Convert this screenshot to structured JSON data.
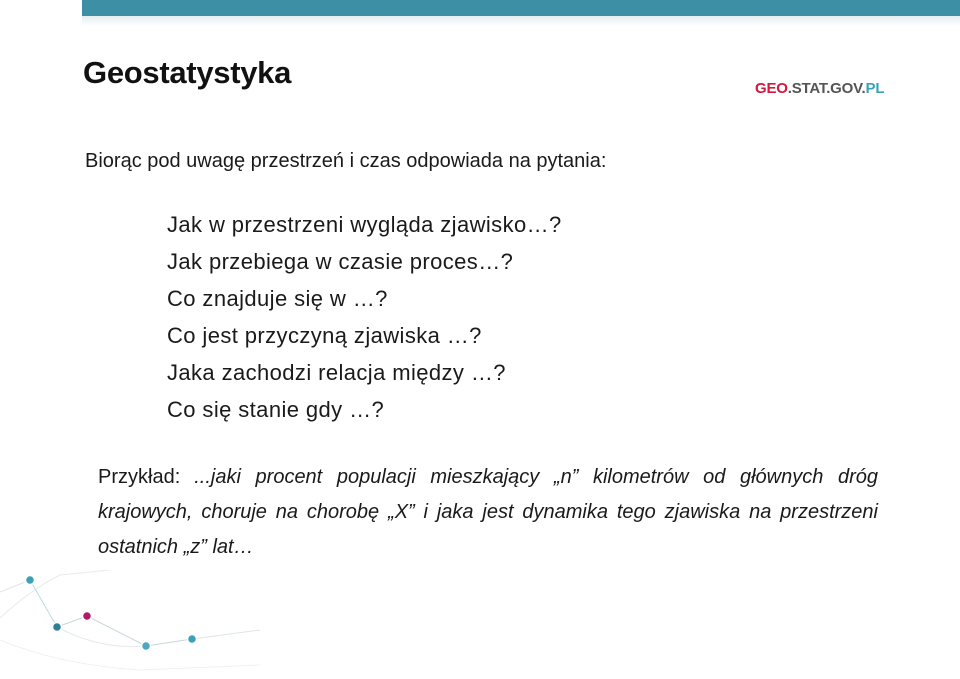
{
  "slide": {
    "title": "Geostatystyka",
    "logo": {
      "part1": "GEO",
      "part2": "STAT",
      "part3": "GOV",
      "part4": "PL"
    },
    "intro": "Biorąc pod uwagę przestrzeń i czas odpowiada na pytania:",
    "questions": [
      "Jak w przestrzeni wygląda zjawisko…?",
      "Jak przebiega w czasie proces…?",
      "Co znajduje się w …?",
      "Co jest przyczyną zjawiska …?",
      "Jaka zachodzi relacja między …?",
      "Co się stanie gdy …?"
    ],
    "example_label": "Przykład:",
    "example_text": "...jaki procent populacji mieszkający „n” kilometrów od głównych dróg  krajowych, choruje na chorobę „X” i jaka jest dynamika tego zjawiska na przestrzeni ostatnich „z” lat…"
  },
  "colors": {
    "accent_teal": "#3d8fa6",
    "logo_red": "#d4173f",
    "logo_blue": "#3aa1b8",
    "dot_magenta": "#b0186a"
  }
}
